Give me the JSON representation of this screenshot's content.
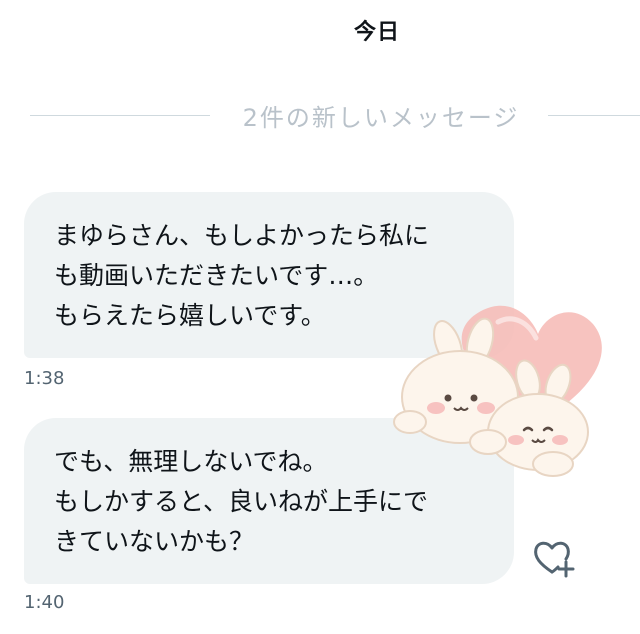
{
  "day_header": "今日",
  "new_messages_divider": "2件の新しいメッセージ",
  "messages": [
    {
      "lines": [
        "まゆらさん、もしよかったら私に",
        "も動画いただきたいです…。",
        "もらえたら嬉しいです。"
      ],
      "time": "1:38"
    },
    {
      "lines": [
        "でも、無理しないでね。",
        "もしかすると、良いねが上手にで",
        "きていないかも？"
      ],
      "time": "1:40"
    }
  ],
  "icons": {
    "sticker": "bunny-heart-sticker",
    "reaction": "heart-plus-icon"
  },
  "colors": {
    "bubble_background": "#eff3f4",
    "divider_text": "#b9c2ca",
    "timestamp_text": "#536471",
    "heart_pink": "#f6b9b4"
  }
}
